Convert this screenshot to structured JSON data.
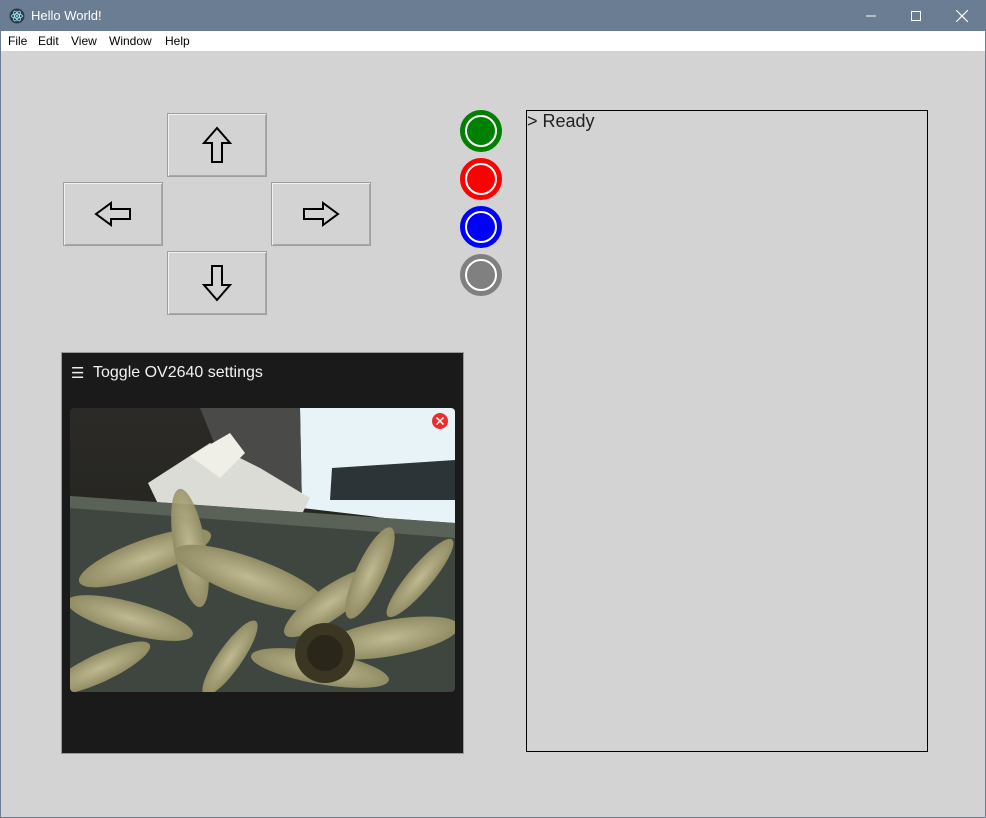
{
  "window": {
    "title": "Hello World!"
  },
  "menu": [
    "File",
    "Edit",
    "View",
    "Window",
    "Help"
  ],
  "directions": {
    "up": "up",
    "left": "left",
    "right": "right",
    "down": "down"
  },
  "indicators": [
    {
      "color": "#008000"
    },
    {
      "color": "#ff0000"
    },
    {
      "color": "#0000ff"
    },
    {
      "color": "#808080"
    }
  ],
  "console": {
    "line": "> Ready"
  },
  "camera": {
    "toggle_label": "Toggle OV2640 settings",
    "menu_icon": "☰"
  }
}
